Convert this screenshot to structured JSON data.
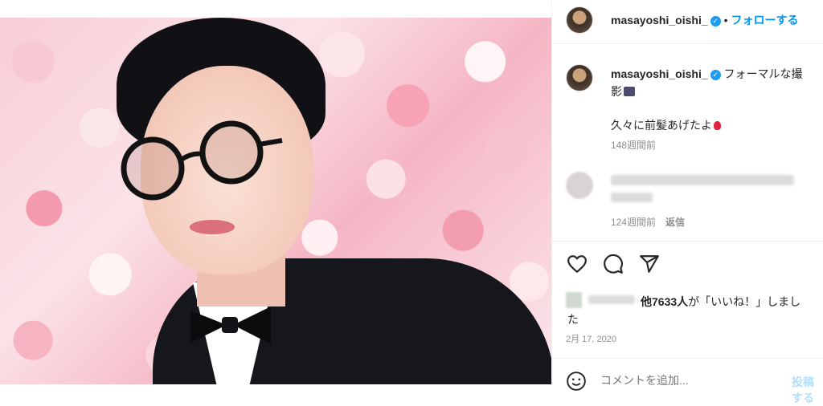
{
  "header": {
    "username": "masayoshi_oishi_",
    "separator": "•",
    "follow_label": "フォローする"
  },
  "caption": {
    "username": "masayoshi_oishi_",
    "text_line1": "フォーマルな撮",
    "text_line2": "影",
    "text_line3": "久々に前髪あげたよ",
    "time": "148週間前"
  },
  "comment": {
    "time": "124週間前",
    "reply_label": "返信"
  },
  "likes": {
    "count_text": "他7633人",
    "suffix": "が「いいね！」しまし",
    "suffix_line2": "た"
  },
  "post_date": "2月 17, 2020",
  "comment_input": {
    "placeholder": "コメントを追加..."
  },
  "post_button_label": "投稿する",
  "icons": {
    "like": "heart-icon",
    "comment": "comment-icon",
    "share": "paper-plane-icon",
    "emoji": "smiley-icon",
    "verified": "verified-badge-icon"
  },
  "colors": {
    "accent": "#0095f6",
    "verified": "#1d9bf0",
    "muted": "#8e8e8e"
  }
}
